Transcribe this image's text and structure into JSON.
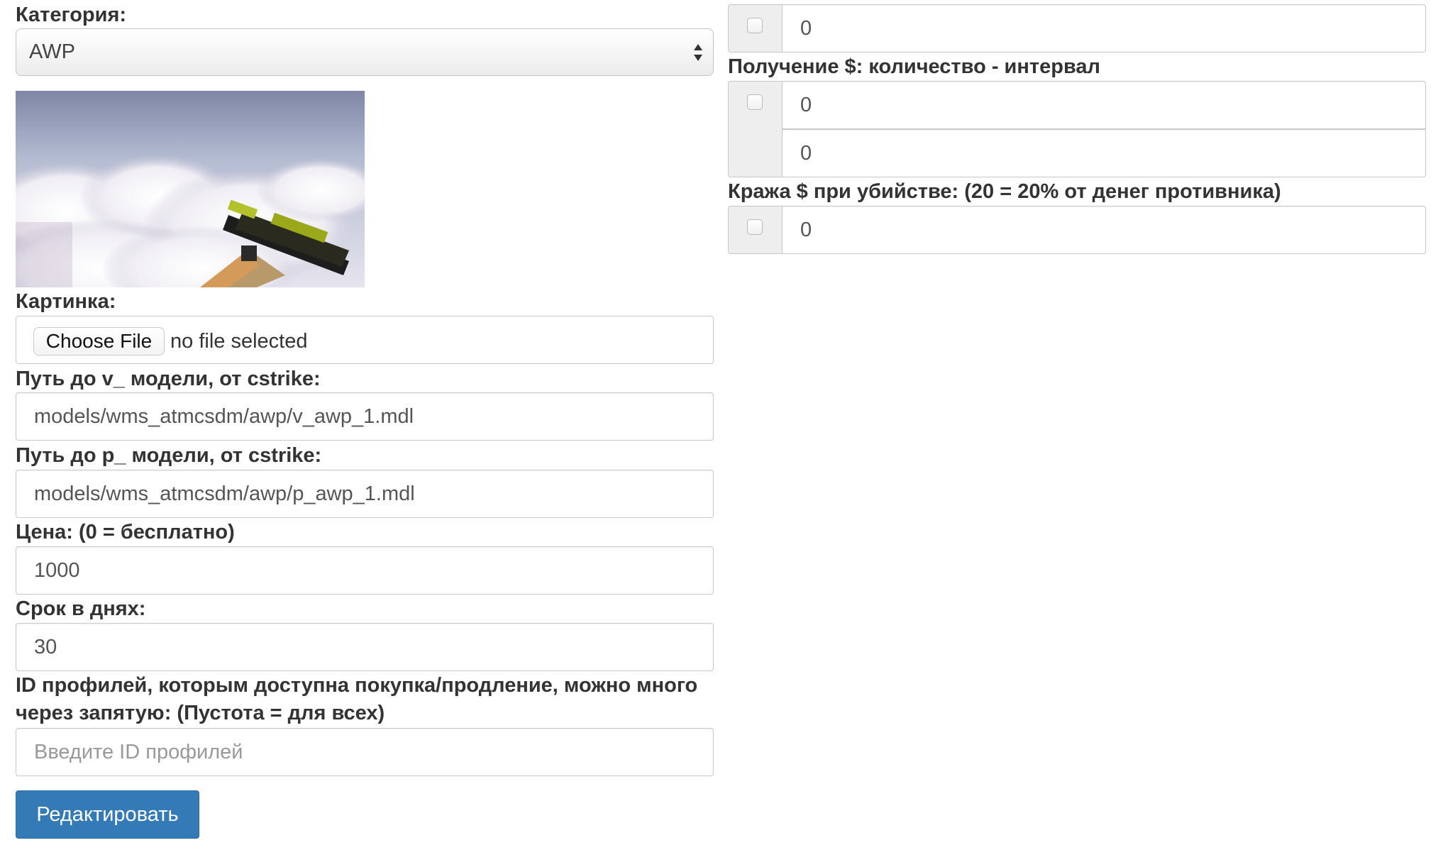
{
  "left": {
    "category_label": "Категория:",
    "category_value": "AWP",
    "image_label": "Картинка:",
    "file_button": "Choose File",
    "file_status": "no file selected",
    "v_model_label": "Путь до v_ модели, от cstrike:",
    "v_model_value": "models/wms_atmcsdm/awp/v_awp_1.mdl",
    "p_model_label": "Путь до p_ модели, от cstrike:",
    "p_model_value": "models/wms_atmcsdm/awp/p_awp_1.mdl",
    "price_label": "Цена: (0 = бесплатно)",
    "price_value": "1000",
    "days_label": "Срок в днях:",
    "days_value": "30",
    "profiles_label": "ID профилей, которым доступна покупка/продление, можно много через запятую: (Пустота = для всех)",
    "profiles_placeholder": "Введите ID профилей",
    "submit": "Редактировать"
  },
  "right": {
    "field1_value": "0",
    "income_label": "Получение $: количество - интервал",
    "income_amount": "0",
    "income_interval": "0",
    "steal_label": "Кража $ при убийстве: (20 = 20% от денег противника)",
    "steal_value": "0"
  }
}
